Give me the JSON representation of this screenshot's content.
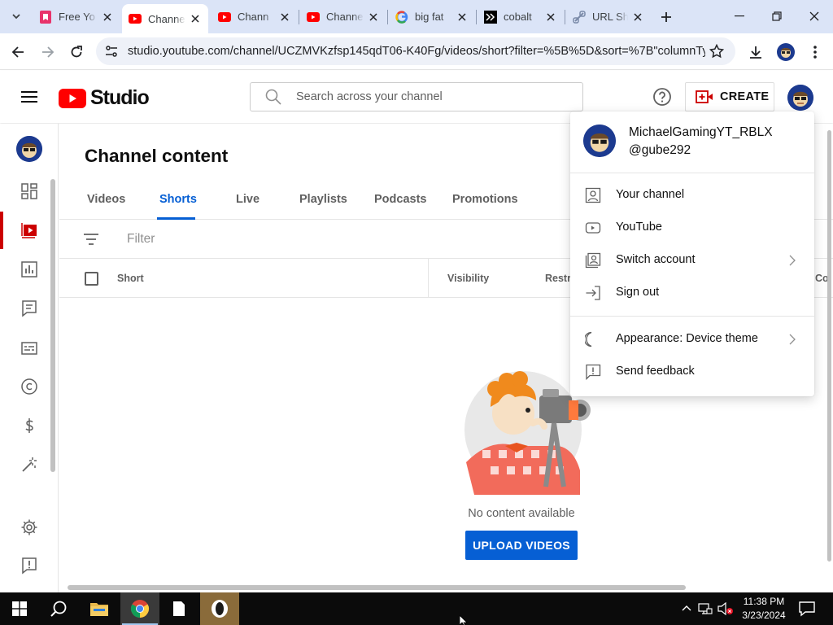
{
  "browser": {
    "tabs": [
      {
        "title": "Free Yo",
        "favicon": "pink-bookmark-icon"
      },
      {
        "title": "Channel",
        "favicon": "youtube-icon",
        "active": true
      },
      {
        "title": "Chann",
        "favicon": "youtube-icon"
      },
      {
        "title": "Channe",
        "favicon": "youtube-icon"
      },
      {
        "title": "big fat",
        "favicon": "google-icon"
      },
      {
        "title": "cobalt",
        "favicon": "cobalt-icon"
      },
      {
        "title": "URL Sh",
        "favicon": "link-icon"
      }
    ],
    "url": "studio.youtube.com/channel/UCZMVKzfsp145qdT06-K40Fg/videos/short?filter=%5B%5D&sort=%7B\"columnTyp..."
  },
  "header": {
    "logo_text": "Studio",
    "search_placeholder": "Search across your channel",
    "create_label": "CREATE"
  },
  "main": {
    "title": "Channel content",
    "tabs": [
      "Videos",
      "Shorts",
      "Live",
      "Playlists",
      "Podcasts",
      "Promotions"
    ],
    "active_tab": "Shorts",
    "filter_placeholder": "Filter",
    "columns": [
      "Short",
      "Visibility",
      "Restri",
      "Co"
    ],
    "empty_text": "No content available",
    "upload_label": "UPLOAD VIDEOS"
  },
  "account_menu": {
    "name": "MichaelGamingYT_RBLX",
    "handle": "@gube292",
    "items": [
      {
        "label": "Your channel",
        "icon": "person-box-icon"
      },
      {
        "label": "YouTube",
        "icon": "youtube-outline-icon"
      },
      {
        "label": "Switch account",
        "icon": "switch-account-icon",
        "submenu": true
      },
      {
        "label": "Sign out",
        "icon": "sign-out-icon"
      }
    ],
    "items2": [
      {
        "label": "Appearance: Device theme",
        "icon": "moon-icon",
        "submenu": true
      },
      {
        "label": "Send feedback",
        "icon": "feedback-icon"
      }
    ]
  },
  "taskbar": {
    "time": "11:38 PM",
    "date": "3/23/2024"
  },
  "colors": {
    "accent": "#065fd4",
    "brand_red": "#ff0000",
    "active_nav": "#cc0000"
  }
}
